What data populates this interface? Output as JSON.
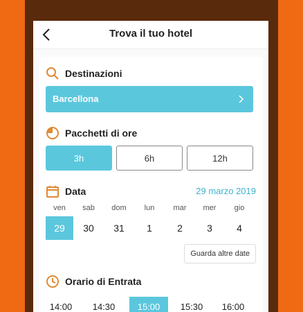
{
  "header": {
    "title": "Trova il tuo hotel"
  },
  "destination": {
    "label": "Destinazioni",
    "value": "Barcellona"
  },
  "packages": {
    "label": "Pacchetti di ore",
    "options": [
      "3h",
      "6h",
      "12h"
    ],
    "selected": "3h"
  },
  "date": {
    "label": "Data",
    "value": "29 marzo 2019",
    "days": [
      {
        "name": "ven",
        "num": "29"
      },
      {
        "name": "sab",
        "num": "30"
      },
      {
        "name": "dom",
        "num": "31"
      },
      {
        "name": "lun",
        "num": "1"
      },
      {
        "name": "mar",
        "num": "2"
      },
      {
        "name": "mer",
        "num": "3"
      },
      {
        "name": "gio",
        "num": "4"
      }
    ],
    "selected": "29",
    "more_label": "Guarda altre date"
  },
  "checkin": {
    "label": "Orario di Entrata",
    "times": [
      "14:00",
      "14:30",
      "15:00",
      "15:30",
      "16:00"
    ],
    "selected": "15:00"
  },
  "colors": {
    "accent": "#5bc7dd",
    "icon": "#e08a35",
    "background": "#ef6a12"
  }
}
